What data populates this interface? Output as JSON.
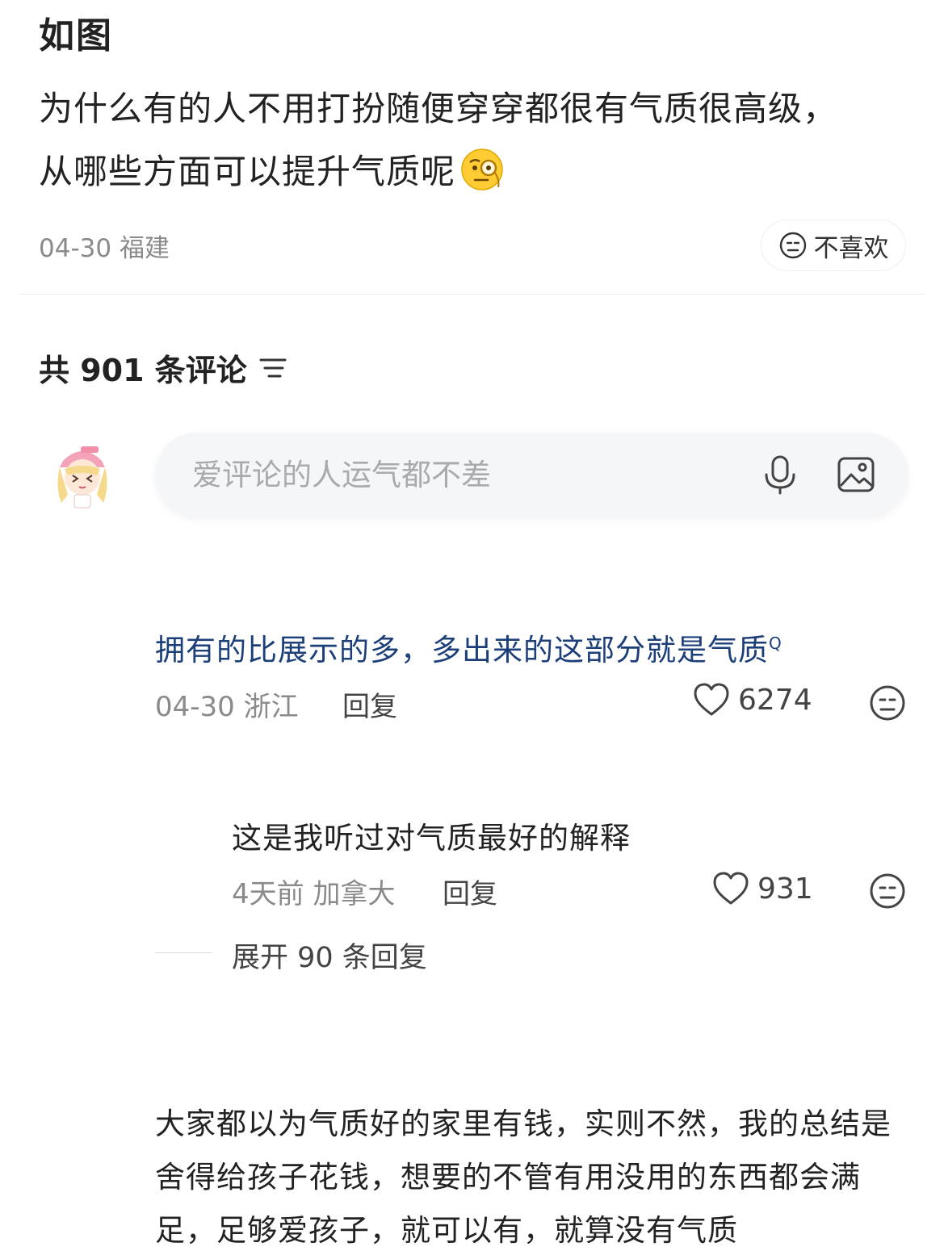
{
  "post": {
    "title": "如图",
    "body": "为什么有的人不用打扮随便穿穿都很有气质很高级，从哪些方面可以提升气质呢",
    "body_emoji": "thinking-monocle-emoji",
    "date": "04-30",
    "location": "福建",
    "dislike_label": "不喜欢"
  },
  "comments_header": {
    "label": "共 901 条评论",
    "sort_icon": "sort-lines-icon"
  },
  "comment_input": {
    "placeholder": "爱评论的人运气都不差",
    "mic_icon": "microphone-icon",
    "image_icon": "image-icon"
  },
  "comments": [
    {
      "text": "拥有的比展示的多，多出来的这部分就是气质",
      "search_mark": "Q",
      "meta": "04-30 浙江",
      "reply_label": "回复",
      "likes": "6274",
      "replies": [
        {
          "text": "这是我听过对气质最好的解释",
          "meta": "4天前 加拿大",
          "reply_label": "回复",
          "likes": "931"
        }
      ],
      "expand_label": "展开 90 条回复"
    },
    {
      "text": "大家都以为气质好的家里有钱，实则不然，我的总结是舍得给孩子花钱，想要的不管有用没用的东西都会满足，足够爱孩子，就可以有，就算没有气质"
    }
  ],
  "colors": {
    "link_blue": "#1c3f7a",
    "muted_gray": "#8a8a8a",
    "input_bg": "#f5f6f8"
  }
}
